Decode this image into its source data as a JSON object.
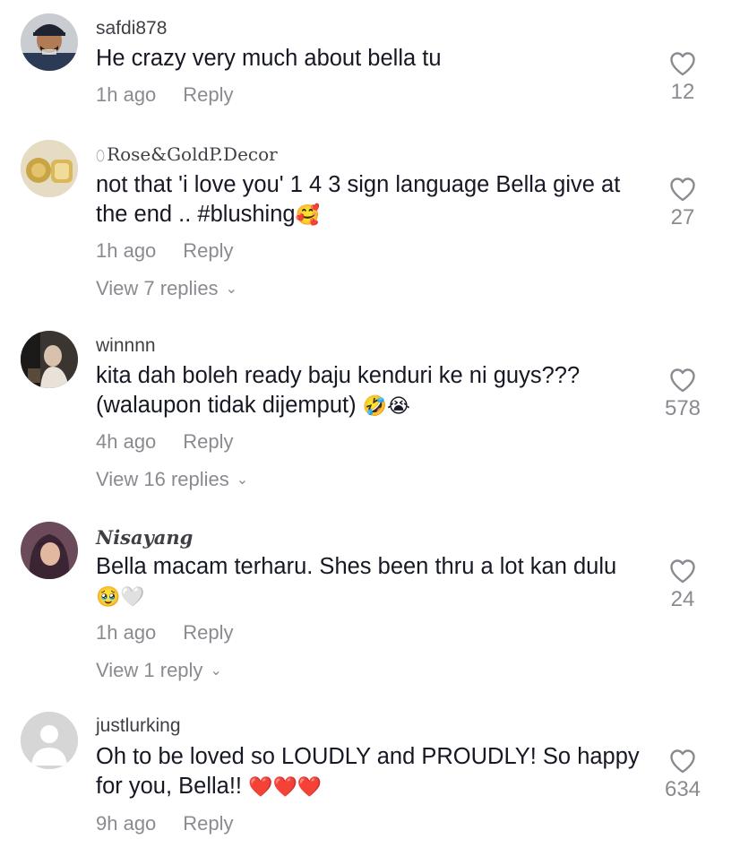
{
  "comments": [
    {
      "username": "safdi878",
      "text": "He crazy very much about bella tu",
      "time": "1h ago",
      "reply_label": "Reply",
      "likes": "12",
      "avatar": "avatar-man-cap"
    },
    {
      "username": "Rose&GoldP.Decor",
      "username_prefix": "⬯",
      "text": "not that 'i love you' 1 4 3 sign language Bella give at the end .. #blushing",
      "emoji": "🥰",
      "time": "1h ago",
      "reply_label": "Reply",
      "likes": "27",
      "view_replies": "View 7 replies",
      "avatar": "avatar-gold"
    },
    {
      "username": "winnnn",
      "text": "kita dah boleh ready baju kenduri ke ni guys??? (walaupon tidak dijemput)",
      "emoji": "🤣😭",
      "time": "4h ago",
      "reply_label": "Reply",
      "likes": "578",
      "view_replies": "View 16 replies",
      "avatar": "avatar-photo"
    },
    {
      "username": "Nisayang",
      "text": "Bella macam terharu. Shes been thru a lot kan dulu",
      "emoji": "🥹🤍",
      "time": "1h ago",
      "reply_label": "Reply",
      "likes": "24",
      "view_replies": "View 1 reply",
      "avatar": "avatar-hijab"
    },
    {
      "username": "justlurking",
      "text": "Oh to be loved so LOUDLY and PROUDLY! So happy for you, Bella!!",
      "emoji": "❤️❤️❤️",
      "time": "9h ago",
      "reply_label": "Reply",
      "likes": "634",
      "avatar": "avatar-default"
    }
  ],
  "icons": {
    "like": "heart-outline-icon",
    "expand": "chevron-down-icon"
  },
  "colors": {
    "text": "#161823",
    "muted": "#8a8b91",
    "username": "#3f3f46",
    "emoji_heart": "#e0212e"
  }
}
